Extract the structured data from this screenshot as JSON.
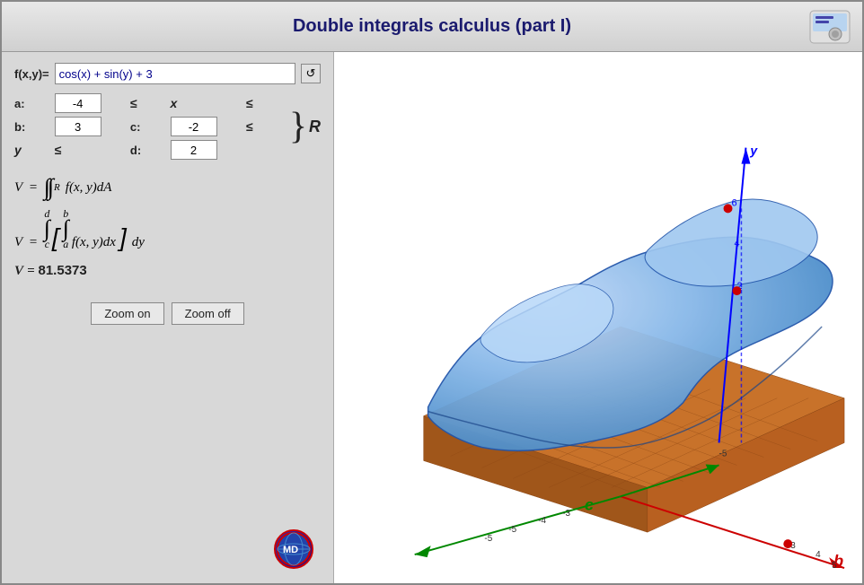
{
  "title": "Double integrals calculus (part I)",
  "function": {
    "label": "f(x,y)=",
    "value": "cos(x) + sin(y) + 3",
    "placeholder": "cos(x) + sin(y) + 3"
  },
  "bounds": {
    "a_label": "a:",
    "a_value": "-4",
    "b_label": "b:",
    "b_value": "3",
    "c_label": "c:",
    "c_value": "-2",
    "d_label": "d:",
    "d_value": "2",
    "x_var": "x",
    "y_var": "y",
    "leq": "≤",
    "R_label": "R"
  },
  "formulas": {
    "line1": "V =",
    "line1_integral": "∬",
    "line1_sub": "R",
    "line1_func": "f(x, y)dA",
    "line2": "V =",
    "line2_d": "d",
    "line2_c": "c",
    "line2_b": "b",
    "line2_a": "a",
    "line2_func": "f(x, y)dx",
    "line2_dy": "dy",
    "result_label": "V =",
    "result_value": "81.5373"
  },
  "buttons": {
    "zoom_on": "Zoom on",
    "zoom_off": "Zoom off"
  },
  "logo": {
    "text": "MD"
  },
  "graph": {
    "axis_y_label": "y",
    "axis_b_label": "b",
    "axis_c_label": "c",
    "y_max": 6,
    "axis_color_y": "#0000ff",
    "axis_color_x": "#cc0000",
    "axis_color_z": "#008800"
  }
}
